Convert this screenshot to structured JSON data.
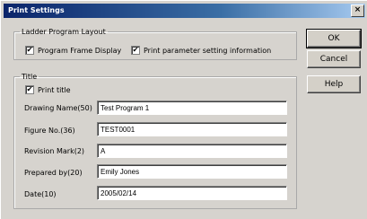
{
  "window": {
    "title": "Print Settings",
    "close_glyph": "×",
    "close_icon": "close-icon"
  },
  "ladder": {
    "legend": "Ladder Program Layout",
    "program_frame_display": {
      "label": "Program Frame Display",
      "checked": true
    },
    "print_parameter": {
      "label": "Print parameter setting information",
      "checked": true
    }
  },
  "title_group": {
    "legend": "Title",
    "print_title": {
      "label": "Print title",
      "checked": true
    },
    "fields": [
      {
        "label": "Drawing Name(50)",
        "value": "Test Program 1"
      },
      {
        "label": "Figure No.(36)",
        "value": "TEST0001"
      },
      {
        "label": "Revision Mark(2)",
        "value": "A"
      },
      {
        "label": "Prepared by(20)",
        "value": "Emily Jones"
      },
      {
        "label": "Date(10)",
        "value": "2005/02/14"
      }
    ]
  },
  "buttons": {
    "ok": "OK",
    "cancel": "Cancel",
    "help": "Help"
  },
  "check_glyph": "✔"
}
